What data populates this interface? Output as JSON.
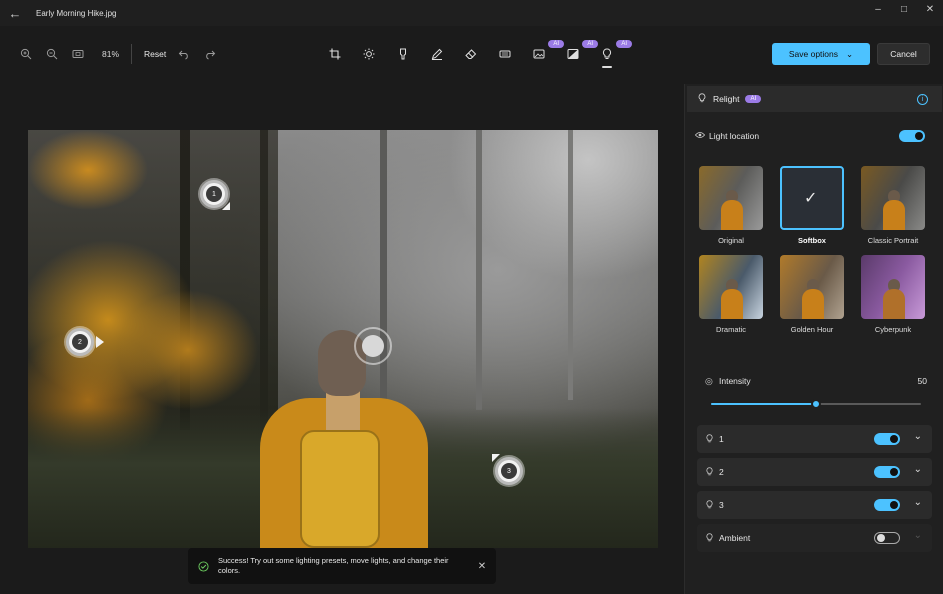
{
  "window": {
    "title": "Early Morning Hike.jpg",
    "controls": [
      "–",
      "□",
      "✕"
    ]
  },
  "toolbar": {
    "zoom": "81%",
    "reset_label": "Reset",
    "ai_label": "AI",
    "save_label": "Save options",
    "cancel_label": "Cancel"
  },
  "canvas": {
    "markers": [
      {
        "label": "1"
      },
      {
        "label": "2"
      },
      {
        "label": "3"
      }
    ]
  },
  "toast": {
    "message": "Success! Try out some lighting presets, move lights, and change their colors."
  },
  "panel": {
    "title": "Relight",
    "ai_label": "AI",
    "light_location_label": "Light location",
    "light_location_on": true,
    "presets": [
      {
        "label": "Original",
        "selected": false
      },
      {
        "label": "Softbox",
        "selected": true
      },
      {
        "label": "Classic Portrait",
        "selected": false
      },
      {
        "label": "Dramatic",
        "selected": false
      },
      {
        "label": "Golden Hour",
        "selected": false
      },
      {
        "label": "Cyberpunk",
        "selected": false
      }
    ],
    "intensity_label": "Intensity",
    "intensity_value": "50",
    "lights": [
      {
        "label": "1",
        "on": true
      },
      {
        "label": "2",
        "on": true
      },
      {
        "label": "3",
        "on": true
      },
      {
        "label": "Ambient",
        "on": false
      }
    ]
  },
  "colors": {
    "accent": "#4cc2ff",
    "ai_badge": "#9b7be6",
    "success": "#6ccb5f"
  }
}
